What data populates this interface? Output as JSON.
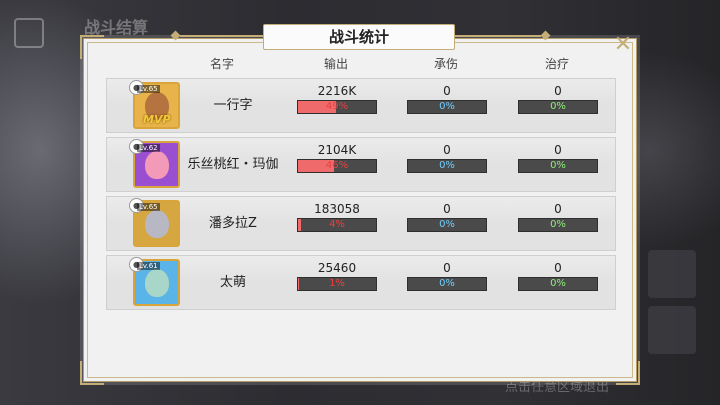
{
  "background": {
    "title": "战斗结算",
    "hint": "点击任意区域退出"
  },
  "dialog": {
    "title": "战斗统计",
    "close_label": "✕",
    "headers": {
      "name": "名字",
      "damage": "输出",
      "tank": "承伤",
      "heal": "治疗"
    }
  },
  "colors": {
    "damage_fill": "#ef6b6b",
    "pct_damage": "#e94040",
    "pct_tank": "#6fd0ff",
    "pct_heal": "#8ff07a",
    "gold": "#c4ad77"
  },
  "rows": [
    {
      "level": "Lv.65",
      "name": "一行字",
      "mvp": "MVP",
      "damage": "2216K",
      "damage_pct": "49%",
      "damage_frac": 0.49,
      "tank": "0",
      "tank_pct": "0%",
      "heal": "0",
      "heal_pct": "0%",
      "avatar_color": "#e8b34a",
      "face_color": "#b5733f"
    },
    {
      "level": "Lv.62",
      "name": "乐丝桃红・玛伽",
      "mvp": "",
      "damage": "2104K",
      "damage_pct": "46%",
      "damage_frac": 0.46,
      "tank": "0",
      "tank_pct": "0%",
      "heal": "0",
      "heal_pct": "0%",
      "avatar_color": "#9a4fd0",
      "face_color": "#f29ab8"
    },
    {
      "level": "Lv.65",
      "name": "潘多拉Z",
      "mvp": "",
      "damage": "183058",
      "damage_pct": "4%",
      "damage_frac": 0.04,
      "tank": "0",
      "tank_pct": "0%",
      "heal": "0",
      "heal_pct": "0%",
      "avatar_color": "#d6a640",
      "face_color": "#b8b8c4"
    },
    {
      "level": "Lv.61",
      "name": "太萌",
      "mvp": "",
      "damage": "25460",
      "damage_pct": "1%",
      "damage_frac": 0.01,
      "tank": "0",
      "tank_pct": "0%",
      "heal": "0",
      "heal_pct": "0%",
      "avatar_color": "#5ab4e8",
      "face_color": "#a8d6c8"
    }
  ]
}
